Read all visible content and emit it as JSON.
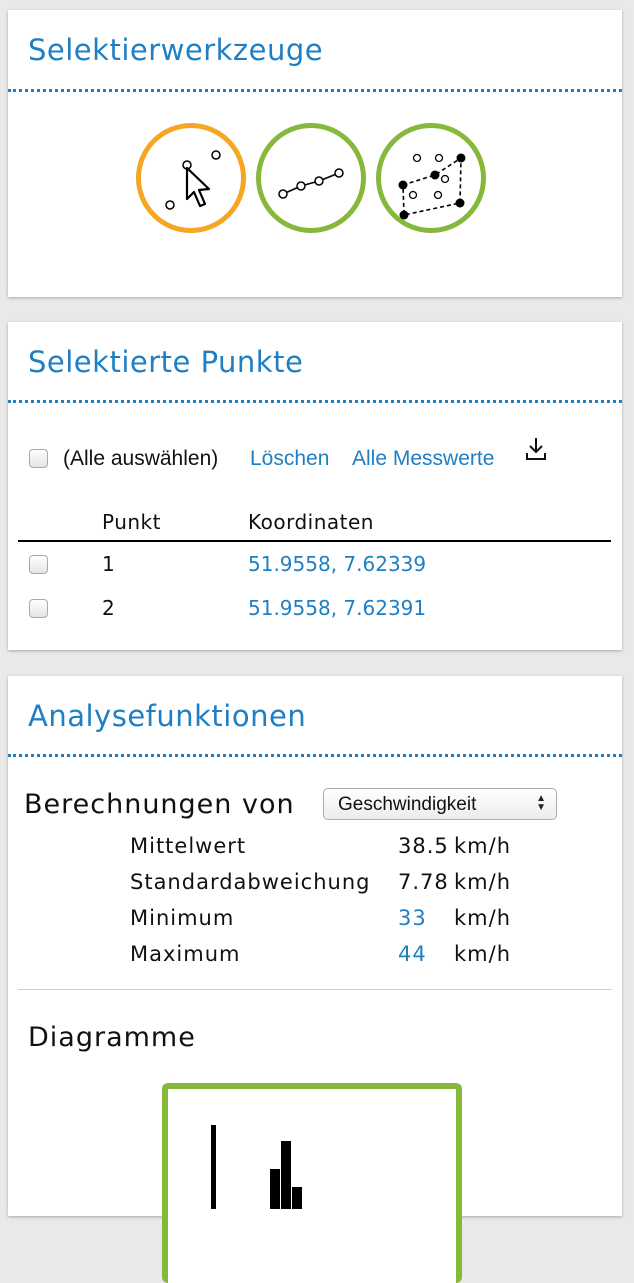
{
  "selection_tools": {
    "title": "Selektierwerkzeuge",
    "colors": {
      "active": "#f5a623",
      "inactive": "#86b83c"
    },
    "tools": [
      {
        "icon": "pointer-select-icon",
        "active": true
      },
      {
        "icon": "line-select-icon",
        "active": false
      },
      {
        "icon": "polygon-select-icon",
        "active": false
      }
    ]
  },
  "selected_points": {
    "title": "Selektierte Punkte",
    "select_all_label": "(Alle auswählen)",
    "delete_link": "Löschen",
    "all_values_link": "Alle Messwerte",
    "download_icon": "download-icon",
    "columns": [
      "Punkt",
      "Koordinaten"
    ],
    "rows": [
      {
        "point": "1",
        "coords": "51.9558, 7.62339"
      },
      {
        "point": "2",
        "coords": "51.9558, 7.62391"
      }
    ]
  },
  "analysis": {
    "title": "Analysefunktionen",
    "calc_label": "Berechnungen von",
    "calc_selected": "Geschwindigkeit",
    "stats": [
      {
        "label": "Mittelwert",
        "value": "38.5",
        "unit": "km/h",
        "link": false
      },
      {
        "label": "Standardabweichung",
        "value": "7.78",
        "unit": "km/h",
        "link": false
      },
      {
        "label": "Minimum",
        "value": "33",
        "unit": "km/h",
        "link": true
      },
      {
        "label": "Maximum",
        "value": "44",
        "unit": "km/h",
        "link": true
      }
    ],
    "diagrams_title": "Diagramme",
    "diagram_icon": "histogram-icon"
  }
}
